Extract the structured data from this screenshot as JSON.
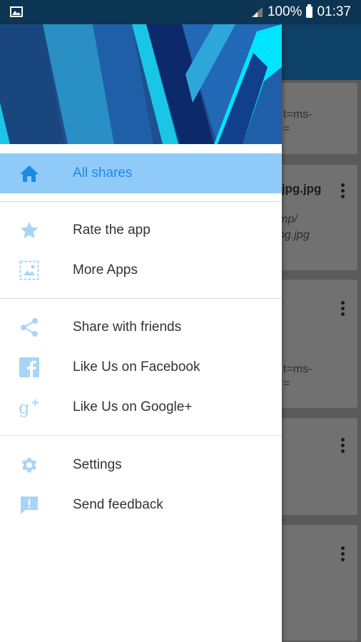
{
  "status_bar": {
    "battery": "100%",
    "time": "01:37"
  },
  "drawer": {
    "items": [
      {
        "label": "All shares",
        "icon": "home-icon",
        "active": true
      },
      {
        "label": "Rate the app",
        "icon": "star-icon"
      },
      {
        "label": "More Apps",
        "icon": "image-icon"
      },
      {
        "label": "Share with friends",
        "icon": "share-icon"
      },
      {
        "label": "Like Us on Facebook",
        "icon": "facebook-icon"
      },
      {
        "label": "Like Us on Google+",
        "icon": "google-plus-icon"
      },
      {
        "label": "Settings",
        "icon": "gear-icon"
      },
      {
        "label": "Send feedback",
        "icon": "feedback-icon"
      }
    ],
    "accent_color": "#1e88e5",
    "active_bg_color": "#90caf9",
    "icon_color": "#a9d4f7"
  },
  "background_list": {
    "cards": [
      {
        "line1": "t=ms-",
        "line2": "="
      },
      {
        "title": ".jpg.jpg",
        "line1": "mp/",
        "line2": "pg.jpg"
      },
      {
        "line1": "t=ms-",
        "line2": "="
      }
    ]
  }
}
